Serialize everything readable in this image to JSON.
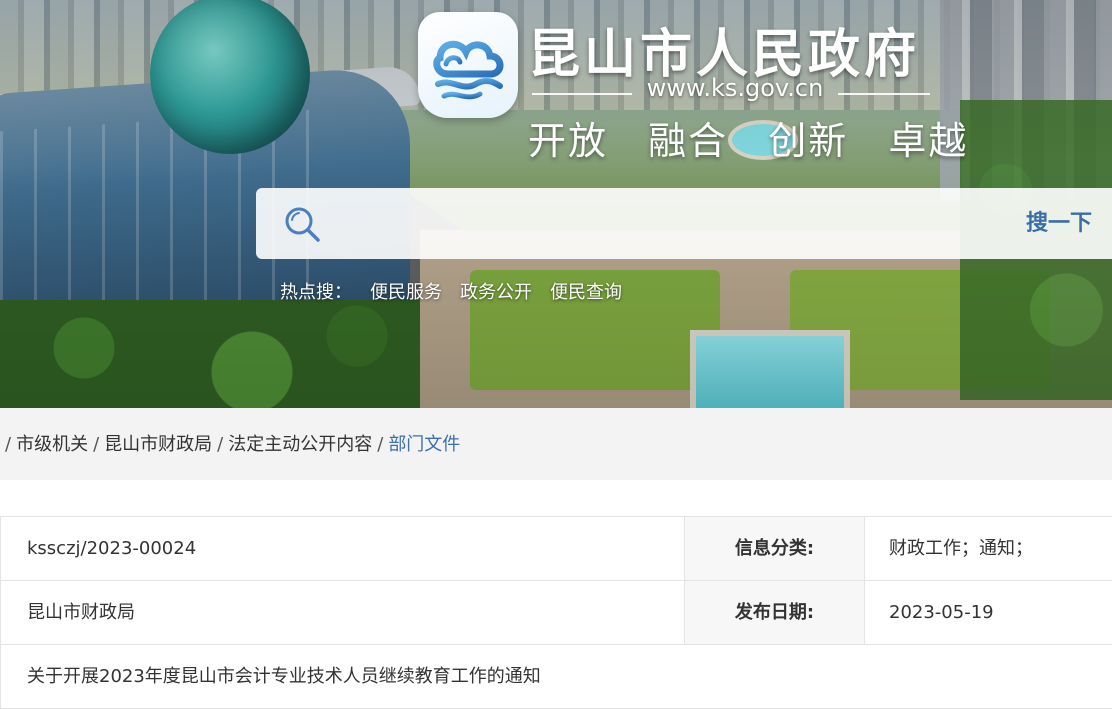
{
  "header": {
    "site_title": "昆山市人民政府",
    "site_url": "www.ks.gov.cn",
    "slogan": [
      "开放",
      "融合",
      "创新",
      "卓越"
    ],
    "logo_icon": "kunshan-cloud-logo-icon"
  },
  "search": {
    "placeholder": "",
    "value": "",
    "button_label": "搜一下",
    "icon": "search-icon",
    "hot_label": "热点搜：",
    "hot_items": [
      "便民服务",
      "政务公开",
      "便民查询"
    ]
  },
  "breadcrumb": {
    "items": [
      "市级机关",
      "昆山市财政局",
      "法定主动公开内容",
      "部门文件"
    ],
    "separator": "/"
  },
  "info": {
    "rows": [
      {
        "value": "kssczj/2023-00024",
        "label": "信息分类:",
        "right_value": "财政工作；通知；"
      },
      {
        "value": "昆山市财政局",
        "label": "发布日期:",
        "right_value": "2023-05-19"
      }
    ],
    "title": "关于开展2023年度昆山市会计专业技术人员继续教育工作的通知"
  },
  "colors": {
    "accent": "#3b6fb0",
    "search_button": "#3a6ea8",
    "crumb_bar": "#f3f3f3",
    "label_bg": "#f7f7f7"
  }
}
